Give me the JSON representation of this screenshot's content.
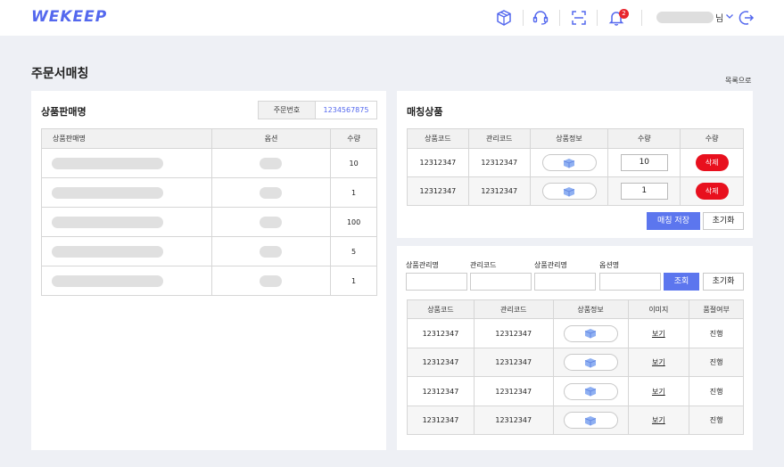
{
  "header": {
    "logo": "WEKEEP",
    "notification_count": "2",
    "user_suffix": "님"
  },
  "page": {
    "title": "주문서매칭",
    "back_label": "목록으로"
  },
  "left": {
    "title": "상품판매명",
    "order_label": "주문번호",
    "order_number": "1234567875",
    "columns": [
      "상품판매명",
      "옵션",
      "수량"
    ],
    "rows": [
      {
        "qty": "10"
      },
      {
        "qty": "1"
      },
      {
        "qty": "100"
      },
      {
        "qty": "5"
      },
      {
        "qty": "1"
      }
    ]
  },
  "matching": {
    "title": "매칭상품",
    "columns": [
      "상품코드",
      "관리코드",
      "상품정보",
      "수량",
      "수량"
    ],
    "rows": [
      {
        "product_code": "12312347",
        "manage_code": "12312347",
        "qty": "10",
        "delete": "삭제"
      },
      {
        "product_code": "12312347",
        "manage_code": "12312347",
        "qty": "1",
        "delete": "삭제"
      }
    ],
    "save_label": "매칭 저장",
    "reset_label": "초기화"
  },
  "search": {
    "labels": [
      "상품관리명",
      "관리코드",
      "상품관리명",
      "옵션명"
    ],
    "search_label": "조회",
    "reset_label": "초기화",
    "columns": [
      "상품코드",
      "관리코드",
      "상품정보",
      "이미지",
      "품절여부"
    ],
    "rows": [
      {
        "product_code": "12312347",
        "manage_code": "12312347",
        "image": "보기",
        "status": "진행"
      },
      {
        "product_code": "12312347",
        "manage_code": "12312347",
        "image": "보기",
        "status": "진행"
      },
      {
        "product_code": "12312347",
        "manage_code": "12312347",
        "image": "보기",
        "status": "진행"
      },
      {
        "product_code": "12312347",
        "manage_code": "12312347",
        "image": "보기",
        "status": "진행"
      }
    ]
  },
  "colors": {
    "accent": "#5468ee",
    "button_primary": "#5c76ee",
    "danger": "#e8101e",
    "background": "#eef0f5"
  },
  "icons": [
    "box-icon",
    "headset-icon",
    "scan-icon",
    "bell-icon",
    "chevron-down-icon",
    "logout-icon",
    "cube-icon"
  ]
}
